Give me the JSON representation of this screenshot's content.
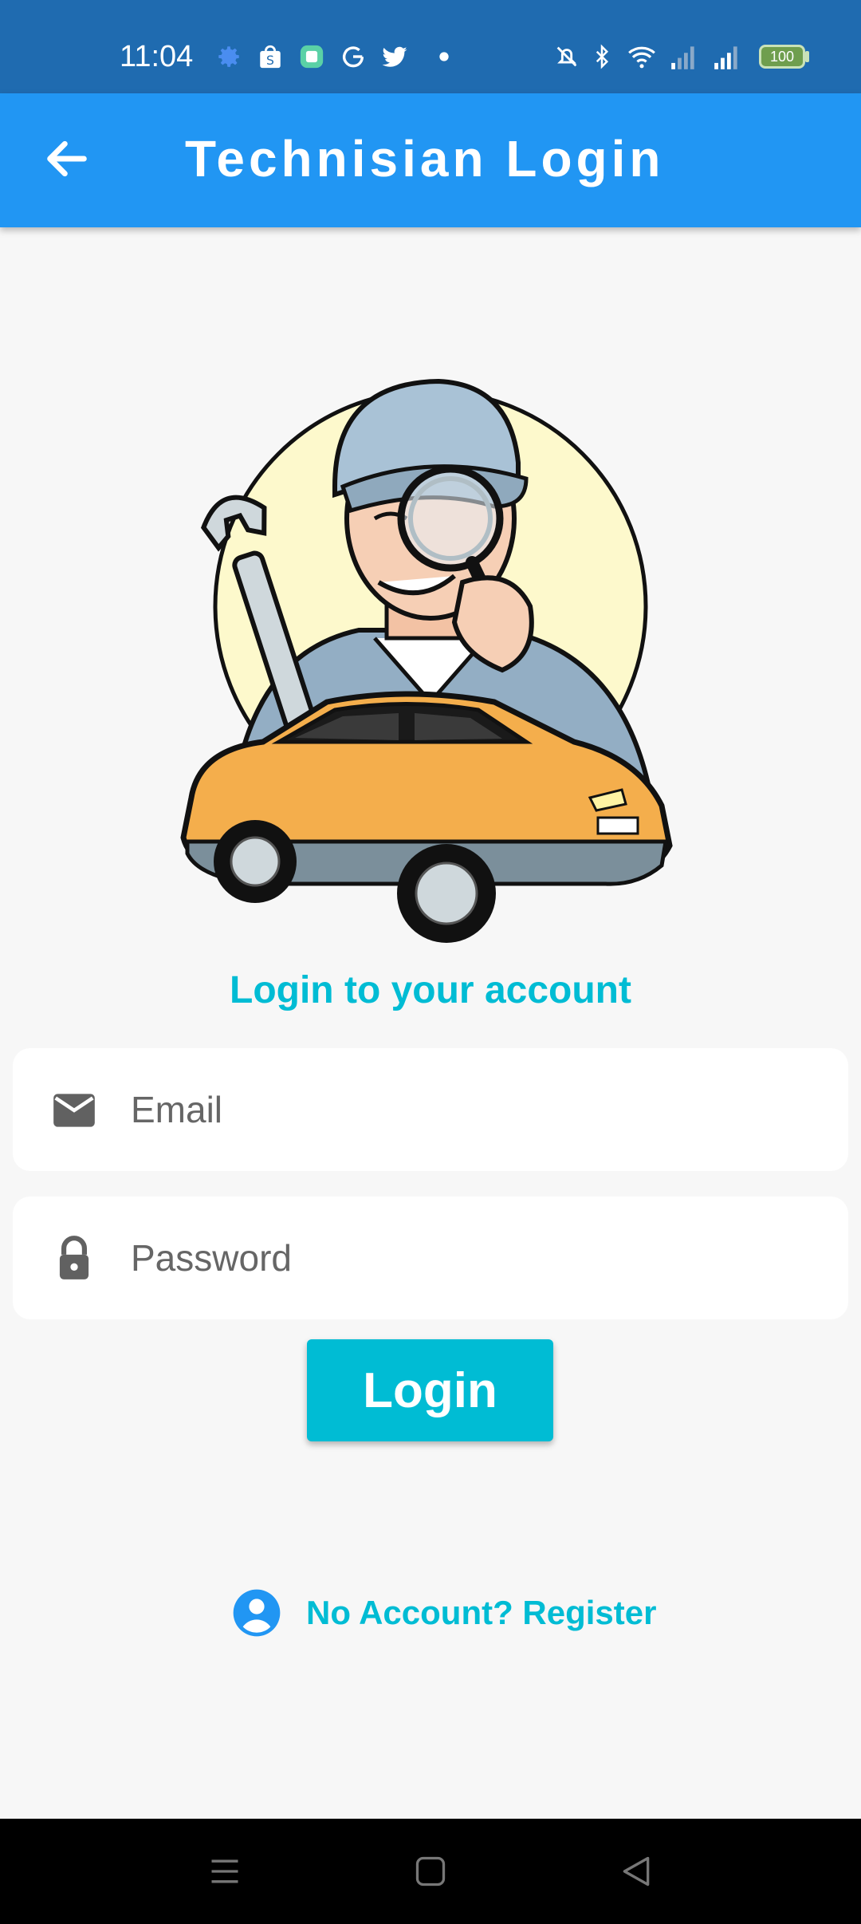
{
  "status_bar": {
    "time": "11:04",
    "battery": "100",
    "icons": [
      "settings-icon",
      "shopee-icon",
      "app-icon",
      "google-icon",
      "twitter-icon",
      "dot-icon",
      "mute-icon",
      "bluetooth-icon",
      "wifi-icon",
      "signal-icon",
      "signal-icon",
      "battery-icon"
    ]
  },
  "app_bar": {
    "title": "Technisian Login",
    "back_icon": "arrow-back-icon"
  },
  "heading": "Login to your account",
  "form": {
    "email_placeholder": "Email",
    "password_placeholder": "Password",
    "login_label": "Login"
  },
  "register": {
    "label": "No Account? Register",
    "icon": "account-circle-icon"
  },
  "colors": {
    "status_bar": "#1f6bb0",
    "app_bar": "#2196f3",
    "accent": "#00bcd4",
    "background": "#f7f7f7"
  }
}
